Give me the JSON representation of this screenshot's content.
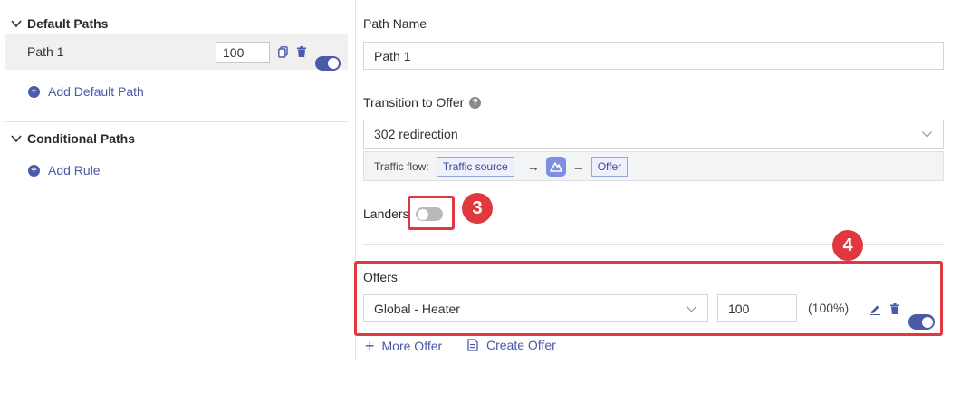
{
  "left": {
    "default_paths": {
      "title": "Default Paths",
      "paths": [
        {
          "name": "Path 1",
          "weight": "100",
          "enabled": true
        }
      ],
      "add_label": "Add Default Path"
    },
    "conditional_paths": {
      "title": "Conditional Paths",
      "add_label": "Add Rule"
    }
  },
  "right": {
    "path_name": {
      "label": "Path Name",
      "value": "Path 1"
    },
    "transition": {
      "label": "Transition to Offer",
      "help_icon": "?",
      "value": "302 redirection",
      "flow": {
        "label": "Traffic flow:",
        "source": "Traffic source",
        "arrow": "→",
        "destination": "Offer"
      }
    },
    "landers": {
      "label": "Landers",
      "enabled": false,
      "callout": "3"
    },
    "offers": {
      "label": "Offers",
      "callout": "4",
      "rows": [
        {
          "offer": "Global - Heater",
          "weight": "100",
          "percent": "(100%)",
          "enabled": true
        }
      ],
      "more_label": "More Offer",
      "create_label": "Create Offer"
    }
  },
  "colors": {
    "accent": "#4a59a8",
    "callout": "#e0383e",
    "row_bg": "#f0f0f0"
  }
}
